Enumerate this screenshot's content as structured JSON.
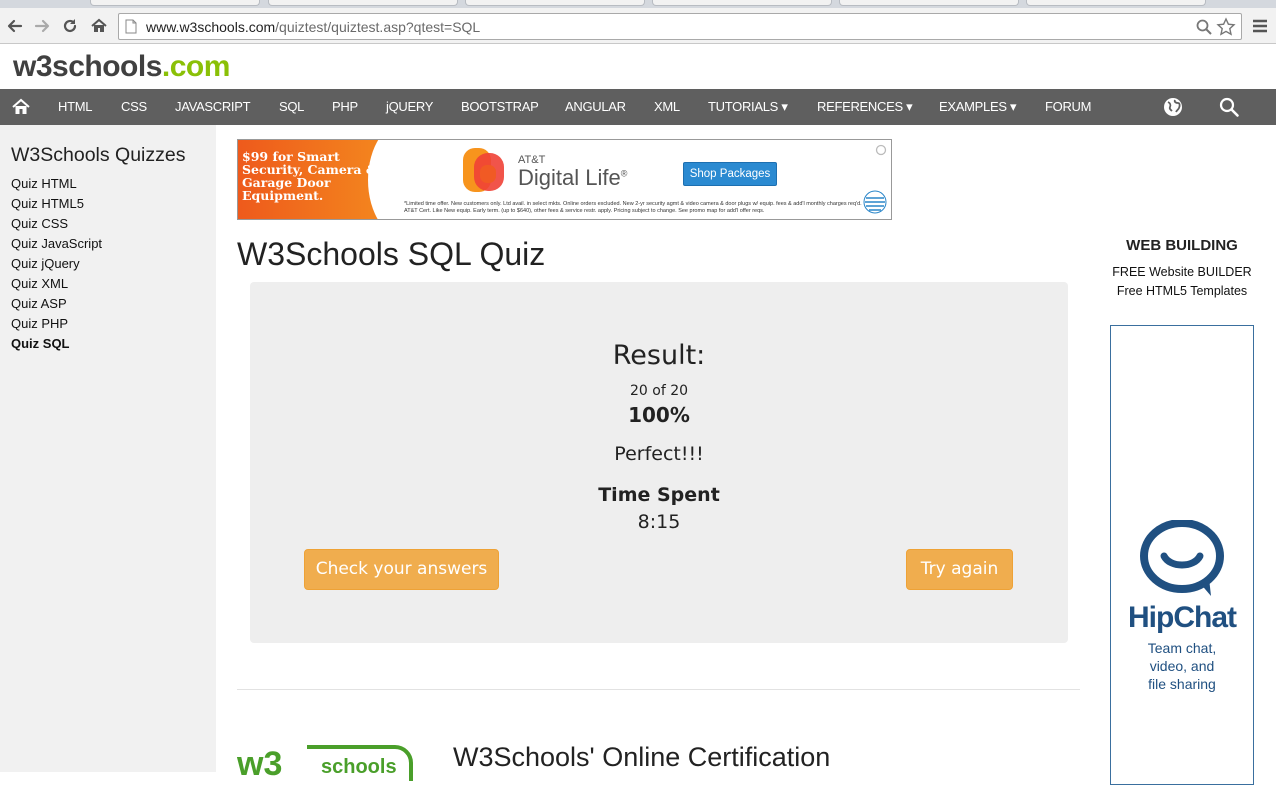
{
  "browser": {
    "url_host": "www.w3schools.com",
    "url_path": "/quiztest/quiztest.asp?qtest=SQL"
  },
  "site": {
    "logo_w3": "w3schools",
    "logo_com": ".com"
  },
  "topnav": {
    "items": [
      "HTML",
      "CSS",
      "JAVASCRIPT",
      "SQL",
      "PHP",
      "jQUERY",
      "BOOTSTRAP",
      "ANGULAR",
      "XML",
      "TUTORIALS ▾",
      "REFERENCES ▾",
      "EXAMPLES ▾",
      "FORUM"
    ]
  },
  "sidebar": {
    "title": "W3Schools Quizzes",
    "links": [
      "Quiz HTML",
      "Quiz HTML5",
      "Quiz CSS",
      "Quiz JavaScript",
      "Quiz jQuery",
      "Quiz XML",
      "Quiz ASP",
      "Quiz PHP",
      "Quiz SQL"
    ],
    "active": "Quiz SQL"
  },
  "ad": {
    "promo": "$99 for Smart Security, Camera & Garage Door Equipment.",
    "brand_small": "AT&T",
    "brand_large": "Digital Life",
    "brand_mark": "®",
    "button": "Shop Packages",
    "fine_print": "*Limited time offer. New customers only. Ltd avail. in select mkts. Online orders excluded. New 2-yr security agmt & video camera & door plugs w/ equip. fees & add'l monthly charges req'd. AT&T Cert. Like New equip. Early term. (up to $640), other fees & service restr. apply. Pricing subject to change. See promo map for add'l offer reqs."
  },
  "main": {
    "title": "W3Schools SQL Quiz",
    "result": {
      "heading": "Result:",
      "count": "20 of 20",
      "percent": "100%",
      "message": "Perfect!!!",
      "time_label": "Time Spent",
      "time_value": "8:15"
    },
    "buttons": {
      "check": "Check your answers",
      "try_again": "Try again"
    },
    "cert_title": "W3Schools' Online Certification"
  },
  "right": {
    "heading": "WEB BUILDING",
    "links": [
      "FREE Website BUILDER",
      "Free HTML5 Templates"
    ],
    "side_ad": {
      "title": "HipChat",
      "lines": [
        "Team chat,",
        "video, and",
        "file sharing"
      ]
    }
  },
  "colors": {
    "nav_bg": "#5f5f5f",
    "accent_green": "#8ac007",
    "button_orange": "#f0ad4e",
    "hipchat_blue": "#205081"
  },
  "icons": {
    "back": "back-arrow-icon",
    "forward": "forward-arrow-icon",
    "reload": "reload-icon",
    "home": "home-icon",
    "globe": "globe-icon",
    "search": "search-icon",
    "star": "star-icon",
    "menu": "hamburger-menu-icon"
  }
}
